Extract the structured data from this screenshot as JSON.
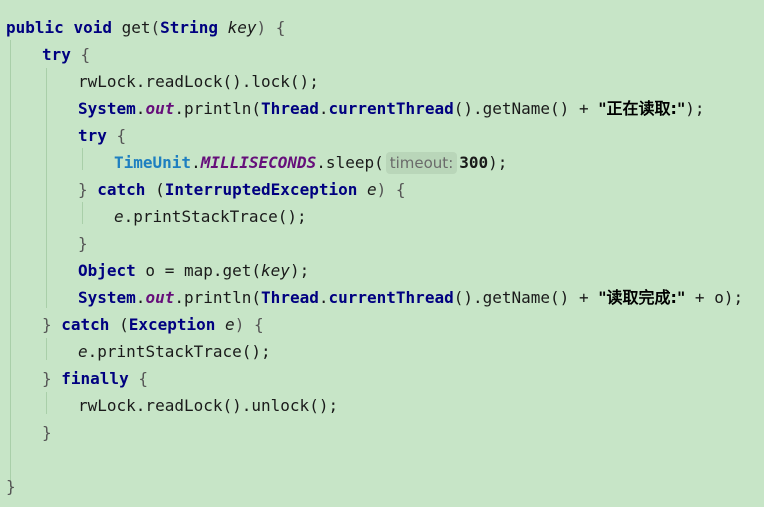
{
  "code": {
    "l1": {
      "kw_public": "public",
      "kw_void": "void",
      "method": "get",
      "open_paren": "(",
      "type_string": "String",
      "param_key": "key",
      "close_brace": ") {"
    },
    "l2": {
      "kw_try": "try",
      "brace": "{"
    },
    "l3": {
      "text": "rwLock.readLock().lock();"
    },
    "l4": {
      "cls_system": "System",
      "dot1": ".",
      "field_out": "out",
      "mid": ".println(",
      "cls_thread": "Thread",
      "dot2": ".",
      "method_current": "currentThread",
      "rest1": "().getName() + ",
      "string": "\"正在读取:\"",
      "end": ");"
    },
    "l5": {
      "kw_try": "try",
      "brace": "{"
    },
    "l6": {
      "cls_timeunit": "TimeUnit",
      "dot": ".",
      "const_ms": "MILLISECONDS",
      "call": ".sleep(",
      "hint": "timeout:",
      "value": "300",
      "end": ");"
    },
    "l7": {
      "close": "} ",
      "kw_catch": "catch",
      "open": " (",
      "cls_ex": "InterruptedException",
      "space": " ",
      "param_e": "e",
      "close2": ") {"
    },
    "l8": {
      "param_e": "e",
      "rest": ".printStackTrace();"
    },
    "l9": {
      "brace": "}"
    },
    "l10": {
      "cls_object": "Object",
      "mid": " o = map.get(",
      "param_key": "key",
      "end": ");"
    },
    "l11": {
      "cls_system": "System",
      "dot1": ".",
      "field_out": "out",
      "mid": ".println(",
      "cls_thread": "Thread",
      "dot2": ".",
      "method_current": "currentThread",
      "rest1": "().getName() + ",
      "string": "\"读取完成:\"",
      "end": " + o);"
    },
    "l12": {
      "close": "} ",
      "kw_catch": "catch",
      "open": " (",
      "cls_ex": "Exception",
      "space": " ",
      "param_e": "e",
      "close2": ") {"
    },
    "l13": {
      "param_e": "e",
      "rest": ".printStackTrace();"
    },
    "l14": {
      "close": "} ",
      "kw_finally": "finally",
      "brace": " {"
    },
    "l15": {
      "text": "rwLock.readLock().unlock();"
    },
    "l16": {
      "brace": "}"
    },
    "l18": {
      "brace": "}"
    }
  }
}
